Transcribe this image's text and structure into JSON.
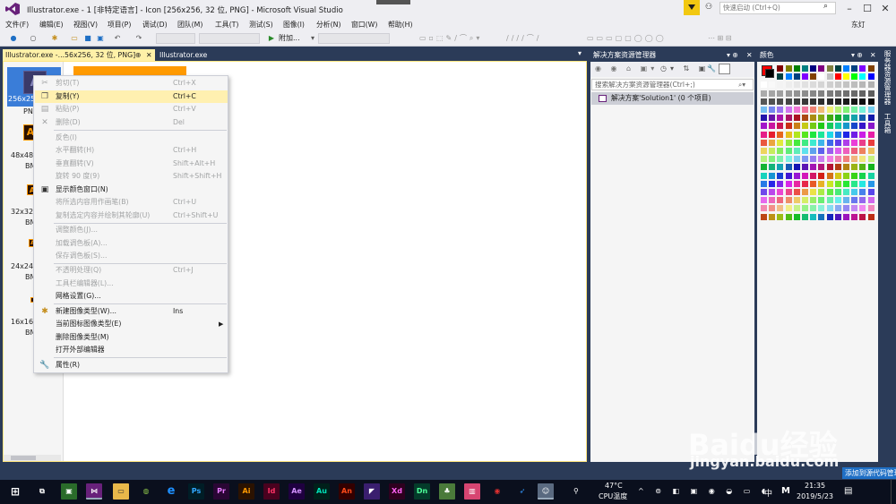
{
  "window": {
    "title": "Illustrator.exe - 1 [非特定语言] - Icon [256x256, 32 位, PNG] - Microsoft Visual Studio",
    "quick_launch_placeholder": "快速启动 (Ctrl+Q)",
    "user": "东灯"
  },
  "menu": [
    "文件(F)",
    "编辑(E)",
    "视图(V)",
    "项目(P)",
    "调试(D)",
    "团队(M)",
    "工具(T)",
    "测试(S)",
    "图像(I)",
    "分析(N)",
    "窗口(W)",
    "帮助(H)"
  ],
  "toolbar": {
    "attach_label": "附加..."
  },
  "tabs": [
    {
      "label": "Illustrator.exe -...56x256, 32 位, PNG]"
    },
    {
      "label": "Illustrator.exe"
    }
  ],
  "thumbnails": [
    {
      "line1": "256x256",
      "line2": "PNG"
    },
    {
      "line1": "48x48,",
      "line2": "BM"
    },
    {
      "line1": "32x32,",
      "line2": "BM"
    },
    {
      "line1": "24x24,",
      "line2": "BM"
    },
    {
      "line1": "16x16,",
      "line2": "BM"
    }
  ],
  "context_menu": [
    {
      "label": "剪切(T)",
      "shortcut": "Ctrl+X",
      "enabled": false,
      "icon": "cut-icon"
    },
    {
      "label": "复制(Y)",
      "shortcut": "Ctrl+C",
      "enabled": true,
      "highlighted": true,
      "icon": "copy-icon"
    },
    {
      "label": "粘贴(P)",
      "shortcut": "Ctrl+V",
      "enabled": false,
      "icon": "paste-icon"
    },
    {
      "label": "删除(D)",
      "shortcut": "Del",
      "enabled": false,
      "icon": "delete-icon"
    },
    {
      "label": "反色(I)",
      "shortcut": "",
      "enabled": false
    },
    {
      "label": "水平翻转(H)",
      "shortcut": "Ctrl+H",
      "enabled": false
    },
    {
      "label": "垂直翻转(V)",
      "shortcut": "Shift+Alt+H",
      "enabled": false
    },
    {
      "label": "旋转 90 度(9)",
      "shortcut": "Shift+Shift+H",
      "enabled": false
    },
    {
      "label": "显示颜色窗口(N)",
      "shortcut": "",
      "enabled": true,
      "icon": "color-window-icon"
    },
    {
      "label": "将所选内容用作画笔(B)",
      "shortcut": "Ctrl+U",
      "enabled": false
    },
    {
      "label": "复制选定内容并绘制其轮廓(U)",
      "shortcut": "Ctrl+Shift+U",
      "enabled": false
    },
    {
      "label": "调整颜色(J)...",
      "shortcut": "",
      "enabled": false
    },
    {
      "label": "加载调色板(A)...",
      "shortcut": "",
      "enabled": false
    },
    {
      "label": "保存调色板(S)...",
      "shortcut": "",
      "enabled": false
    },
    {
      "label": "不透明处理(Q)",
      "shortcut": "Ctrl+J",
      "enabled": false
    },
    {
      "label": "工具栏编辑器(L)...",
      "shortcut": "",
      "enabled": false
    },
    {
      "label": "网格设置(G)...",
      "shortcut": "",
      "enabled": true
    },
    {
      "label": "新建图像类型(W)...",
      "shortcut": "Ins",
      "enabled": true,
      "icon": "new-image-type-icon"
    },
    {
      "label": "当前图标图像类型(E)",
      "shortcut": "",
      "enabled": true,
      "submenu": true
    },
    {
      "label": "删除图像类型(M)",
      "shortcut": "",
      "enabled": true
    },
    {
      "label": "打开外部编辑器",
      "shortcut": "",
      "enabled": true
    },
    {
      "label": "属性(R)",
      "shortcut": "",
      "enabled": true,
      "icon": "wrench-icon"
    }
  ],
  "solution_explorer": {
    "title": "解决方案资源管理器",
    "search_placeholder": "搜索解决方案资源管理器(Ctrl+;)",
    "root": "解决方案'Solution1' (0 个项目)"
  },
  "colors_panel": {
    "title": "颜色",
    "swatch_colors": [
      "#000000",
      "#808080",
      "#800000",
      "#808000",
      "#008000",
      "#008080",
      "#000080",
      "#800080",
      "#808040",
      "#004040",
      "#0080ff",
      "#004080",
      "#8000ff",
      "#804000",
      "#ffffff",
      "#c0c0c0",
      "#ff0000",
      "#ffff00",
      "#00ff00",
      "#00ffff",
      "#0000ff",
      "#ff00ff",
      "#ffff80",
      "#00ff80",
      "#80ffff",
      "#8080ff",
      "#ff0080",
      "#ff8040"
    ]
  },
  "side_tabs": [
    "服务器资源管理器",
    "工具箱"
  ],
  "status_bar": {
    "source_control": "添加到源代码管理"
  },
  "watermark": {
    "text": "Baidu经验",
    "url": "jingyan.baidu.com"
  },
  "taskbar": {
    "apps": [
      "Ps",
      "Pr",
      "Ai",
      "Id",
      "Ae",
      "Au",
      "An",
      "Xd",
      "Dn"
    ],
    "cpu_temp": "47°C",
    "cpu_label": "CPU温度",
    "ime": "中",
    "time": "21:35",
    "date": "2019/5/23"
  }
}
